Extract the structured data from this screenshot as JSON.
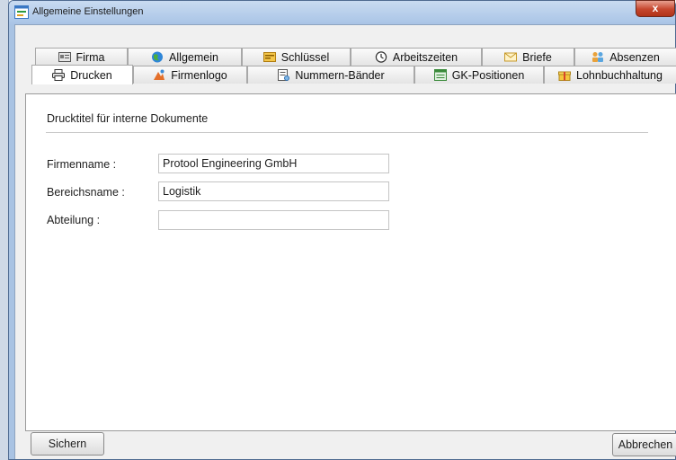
{
  "window": {
    "title": "Allgemeine Einstellungen",
    "close_label": "x"
  },
  "tabs": {
    "row1": [
      {
        "label": "Firma",
        "icon": "company-card-icon"
      },
      {
        "label": "Allgemein",
        "icon": "globe-icon"
      },
      {
        "label": "Schlüssel",
        "icon": "key-card-icon"
      },
      {
        "label": "Arbeitszeiten",
        "icon": "clock-icon"
      },
      {
        "label": "Briefe",
        "icon": "envelope-icon"
      },
      {
        "label": "Absenzen",
        "icon": "absence-icon"
      }
    ],
    "row2": [
      {
        "label": "Drucken",
        "icon": "printer-icon",
        "selected": true
      },
      {
        "label": "Firmenlogo",
        "icon": "logo-icon"
      },
      {
        "label": "Nummern-Bänder",
        "icon": "number-bands-icon"
      },
      {
        "label": "GK-Positionen",
        "icon": "positions-icon"
      },
      {
        "label": "Lohnbuchhaltung",
        "icon": "gift-icon"
      }
    ]
  },
  "panel": {
    "section_title": "Drucktitel für interne Dokumente",
    "fields": [
      {
        "label": "Firmenname :",
        "value": "Protool Engineering GmbH"
      },
      {
        "label": "Bereichsname :",
        "value": "Logistik"
      },
      {
        "label": "Abteilung :",
        "value": ""
      }
    ]
  },
  "buttons": {
    "save": "Sichern",
    "cancel": "Abbrechen"
  },
  "colors": {
    "title_bar": "#a9c4e6",
    "close_button": "#c5462d",
    "panel_background": "#ffffff",
    "dialog_background": "#f0f0f0"
  }
}
